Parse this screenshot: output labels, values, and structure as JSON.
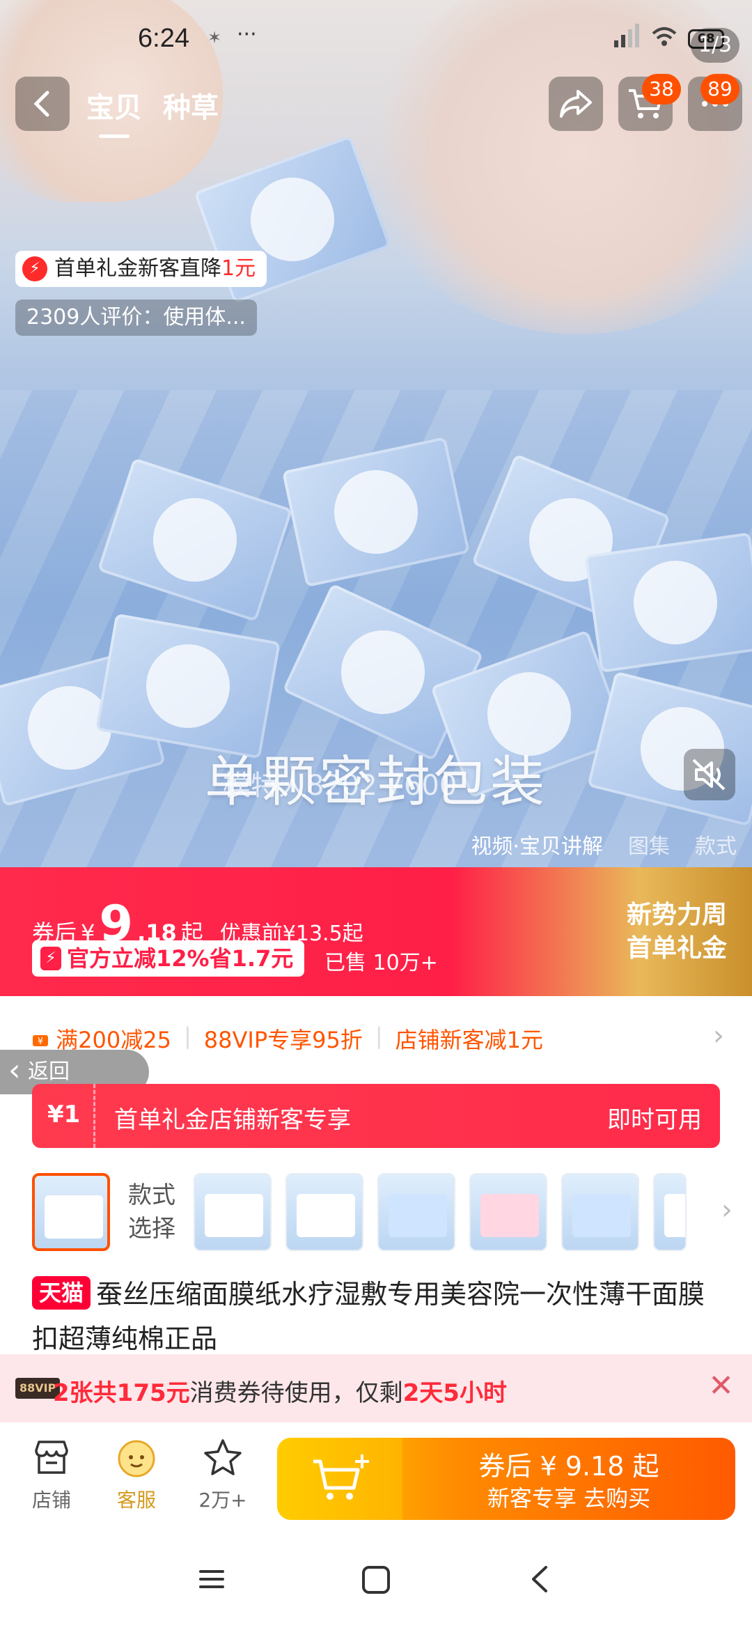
{
  "status_bar": {
    "time": "6:24",
    "battery": "68",
    "extra_icons": [
      "notification-icon",
      "more-dots-icon"
    ],
    "right_icons": [
      "signal-icon",
      "wifi-icon",
      "battery-icon"
    ]
  },
  "nav": {
    "tabs": [
      {
        "label": "宝贝"
      },
      {
        "label": "种草"
      }
    ],
    "cart_badge": "38",
    "more_badge": "89",
    "page_indicator": "1/3"
  },
  "hero": {
    "gift_tag": {
      "prefix": "首单礼金新客直降",
      "amount": "1元"
    },
    "review_tag": "2309人评价：使用体...",
    "caption": "单颗密封包装",
    "watermark": "模特人8202 7600",
    "media_tabs": [
      {
        "label": "视频·宝贝讲解",
        "active": true
      },
      {
        "label": "图集",
        "active": false
      },
      {
        "label": "款式",
        "active": false
      }
    ]
  },
  "price": {
    "prefix": "券后",
    "currency": "¥",
    "integer": "9",
    "decimal": ".18",
    "suffix": "起",
    "original": "优惠前¥13.5起",
    "discount_pill": "官方立减12%省1.7元",
    "sold": "已售 10万+",
    "promo_line1": "新势力周",
    "promo_line2": "首单礼金"
  },
  "coupons": {
    "items": [
      "满200减25",
      "88VIP专享95折",
      "店铺新客减1元"
    ],
    "back_label": "返回"
  },
  "gift_bar": {
    "amount": "¥1",
    "text": "首单礼金店铺新客专享",
    "action": "即时可用"
  },
  "variants": {
    "label": "款式选择",
    "thumbs": [
      "white",
      "white",
      "white",
      "blue",
      "pink",
      "blue",
      "white"
    ]
  },
  "product": {
    "badge": "天猫",
    "title": "蚕丝压缩面膜纸水疗湿敷专用美容院一次性薄干面膜扣超薄纯棉正品"
  },
  "vip": {
    "icon_label": "88VIP",
    "part1": "2张共175元",
    "part2": "消费券待使用，仅剩",
    "part3": "2天5小时"
  },
  "actions": {
    "shop": "店铺",
    "service": "客服",
    "favorite": "2万+",
    "buy_line1": "券后 ¥ 9.18 起",
    "buy_line2": "新客专享  去购买"
  },
  "colors": {
    "brand_orange": "#ff5000",
    "price_red": "#ff1f47",
    "tmall_red": "#ff0036",
    "vip_pink": "#fde7ea"
  }
}
